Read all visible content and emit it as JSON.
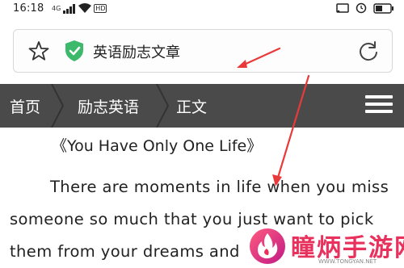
{
  "status_bar": {
    "time": "16:18",
    "network_label": "4G",
    "signal_bars": "signal-icon",
    "wifi": "wifi-icon",
    "hd_label": "HD",
    "cast": "cast-icon",
    "battery_level": 0.45
  },
  "address_bar": {
    "page_title": "英语励志文章"
  },
  "nav": {
    "crumbs": [
      "首页",
      "励志英语",
      "正文"
    ]
  },
  "article": {
    "title": "《You Have Only One Life》",
    "lines": [
      "There are moments in life when you miss",
      "someone so much that you just want to pick",
      "them from your dreams and"
    ]
  },
  "watermark": {
    "name": "瞳炳手游网",
    "url": "WWW.TONGYAN.NET"
  },
  "colors": {
    "nav_bg": "#4a4a4a",
    "shield_green": "#3cb96a",
    "arrow_red": "#e83a3a",
    "watermark_pink": "#e8325d"
  }
}
